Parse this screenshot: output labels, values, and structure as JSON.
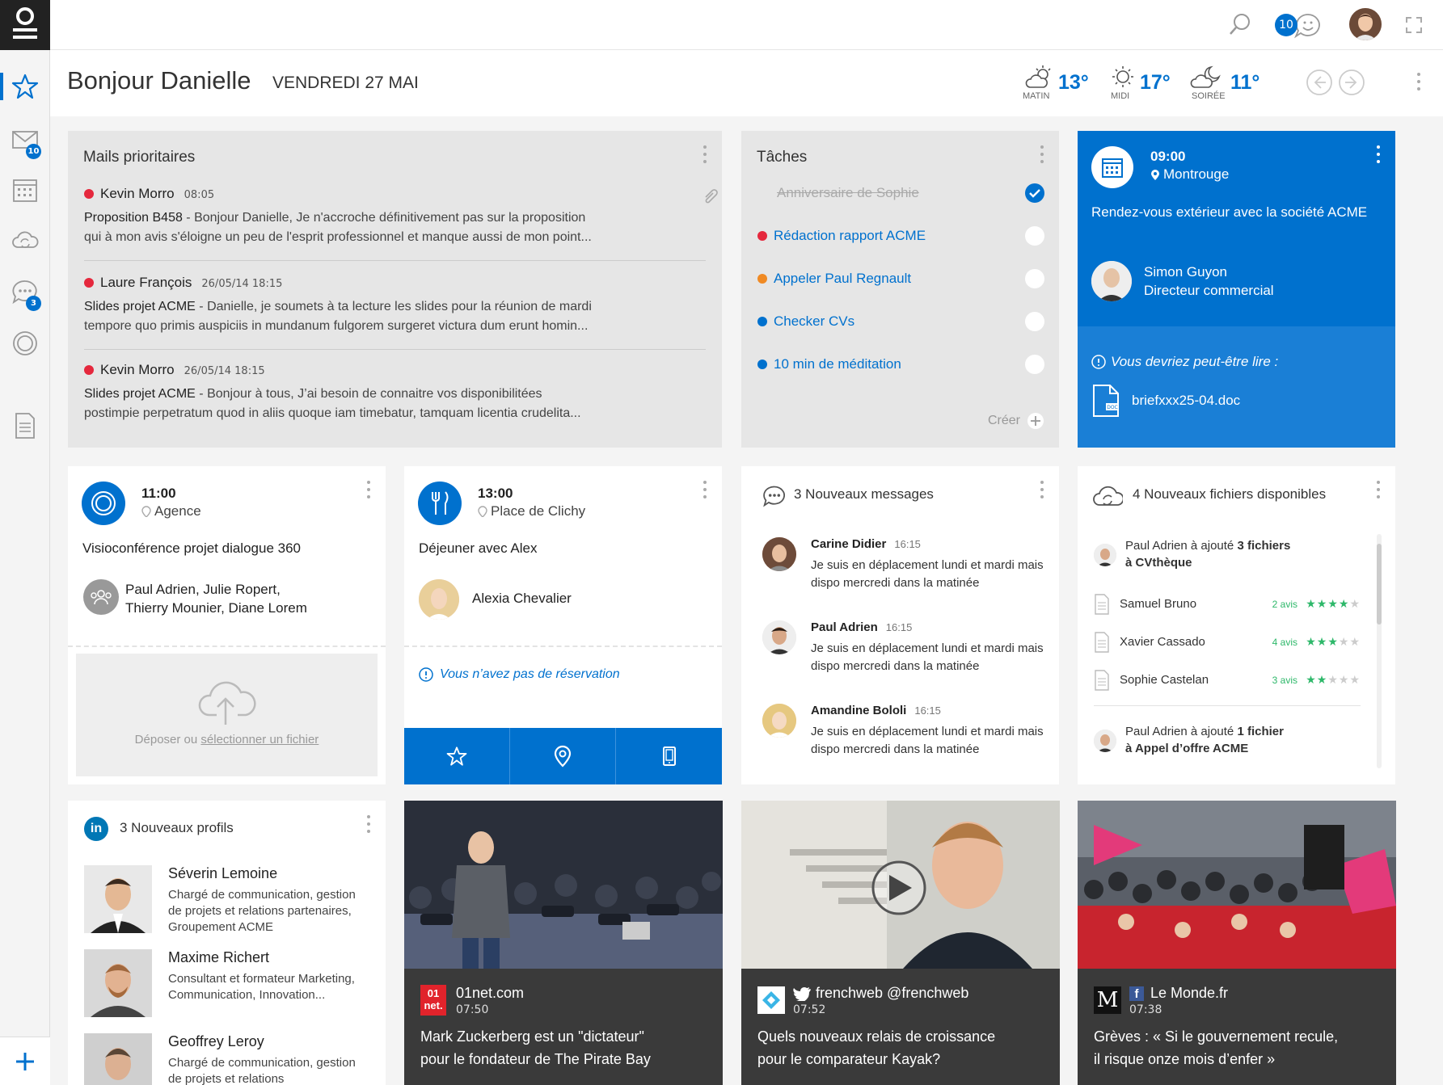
{
  "sidebar": {
    "mail_badge": "10",
    "chat_badge": "3"
  },
  "topbar": {
    "notif_count": "10"
  },
  "header": {
    "greeting": "Bonjour Danielle",
    "date": "VENDREDI 27 MAI",
    "weather": [
      {
        "temp": "13°",
        "label": "MATIN"
      },
      {
        "temp": "17°",
        "label": "MIDI"
      },
      {
        "temp": "11°",
        "label": "SOIRÉE"
      }
    ]
  },
  "mails": {
    "title": "Mails prioritaires",
    "items": [
      {
        "from": "Kevin Morro",
        "time": "08:05",
        "subject": "Proposition B458",
        "line1": " - Bonjour Danielle, Je n'accroche définitivement pas sur la proposition",
        "line2": "qui à mon avis s'éloigne un peu de l'esprit professionnel et manque aussi de mon point..."
      },
      {
        "from": "Laure François",
        "time": "26/05/14 18:15",
        "subject": "Slides projet ACME",
        "line1": " - Danielle, je soumets à ta lecture les slides pour la réunion de mardi",
        "line2": "tempore quo primis auspiciis in mundanum fulgorem surgeret victura dum erunt homin..."
      },
      {
        "from": "Kevin Morro",
        "time": "26/05/14 18:15",
        "subject": "Slides projet ACME",
        "line1": " - Bonjour à tous, J’ai besoin de connaitre vos disponibilitées",
        "line2": "postimpie perpetratum quod in aliis quoque iam timebatur, tamquam licentia crudelita..."
      }
    ]
  },
  "tasks": {
    "title": "Tâches",
    "items": [
      {
        "label": "Anniversaire de Sophie"
      },
      {
        "label": "Rédaction rapport ACME"
      },
      {
        "label": "Appeler Paul Regnault"
      },
      {
        "label": "Checker CVs"
      },
      {
        "label": "10 min de méditation"
      }
    ],
    "create_label": "Créer"
  },
  "meeting": {
    "time": "09:00",
    "place": "Montrouge",
    "title": "Rendez-vous extérieur avec la société ACME",
    "contact_name": "Simon Guyon",
    "contact_role": "Directeur commercial",
    "read_hint": "Vous devriez peut-être lire :",
    "file": "briefxxx25-04.doc"
  },
  "visio": {
    "time": "11:00",
    "place": "Agence",
    "title": "Visioconférence projet dialogue 360",
    "people_line1": "Paul Adrien, Julie Ropert,",
    "people_line2": "Thierry Mounier, Diane Lorem",
    "drop_label_prefix": "Déposer ou ",
    "drop_label_link": "sélectionner un fichier"
  },
  "lunch": {
    "time": "13:00",
    "place": "Place de Clichy",
    "title": "Déjeuner avec Alex",
    "person": "Alexia Chevalier",
    "no_reservation": "Vous n’avez pas de réservation"
  },
  "messages": {
    "title": "3 Nouveaux messages",
    "items": [
      {
        "name": "Carine Didier",
        "time": "16:15",
        "text": "Je suis en déplacement lundi et mardi mais dispo mercredi dans la matinée"
      },
      {
        "name": "Paul Adrien",
        "time": "16:15",
        "text": "Je suis en déplacement lundi et mardi mais dispo mercredi dans la matinée"
      },
      {
        "name": "Amandine Bololi",
        "time": "16:15",
        "text": "Je suis en déplacement lundi et mardi mais dispo mercredi dans la matinée"
      }
    ]
  },
  "files": {
    "title": "4 Nouveaux fichiers disponibles",
    "added1_prefix": "Paul Adrien à ajouté ",
    "added1_count": "3 fichiers",
    "added1_target": "à CVthèque",
    "items": [
      {
        "name": "Samuel Bruno",
        "avis": "2 avis",
        "rating": 4
      },
      {
        "name": "Xavier Cassado",
        "avis": "4 avis",
        "rating": 3
      },
      {
        "name": "Sophie Castelan",
        "avis": "3 avis",
        "rating": 2
      }
    ],
    "added2_prefix": "Paul Adrien à ajouté ",
    "added2_count": "1 fichier",
    "added2_target": "à Appel d’offre ACME"
  },
  "profiles": {
    "title": "3 Nouveaux profils",
    "items": [
      {
        "name": "Séverin Lemoine",
        "desc": "Chargé de communication, gestion de projets et relations partenaires, Groupement ACME"
      },
      {
        "name": "Maxime Richert",
        "desc": "Consultant et formateur Marketing, Communication, Innovation..."
      },
      {
        "name": "Geoffrey Leroy",
        "desc": "Chargé de communication, gestion de projets et relations"
      }
    ]
  },
  "news": [
    {
      "source": "01net.com",
      "logo": "01 net.",
      "time": "07:50",
      "title1": "Mark Zuckerberg est un \"dictateur\"",
      "title2": "pour le fondateur de The Pirate Bay"
    },
    {
      "source": "frenchweb @frenchweb",
      "time": "07:52",
      "title1": "Quels nouveaux relais de croissance",
      "title2": "pour le comparateur Kayak?"
    },
    {
      "source": "Le Monde.fr",
      "logo": "M",
      "time": "07:38",
      "title1": "Grèves : « Si le gouvernement recule,",
      "title2": "il risque onze mois d’enfer »"
    }
  ]
}
